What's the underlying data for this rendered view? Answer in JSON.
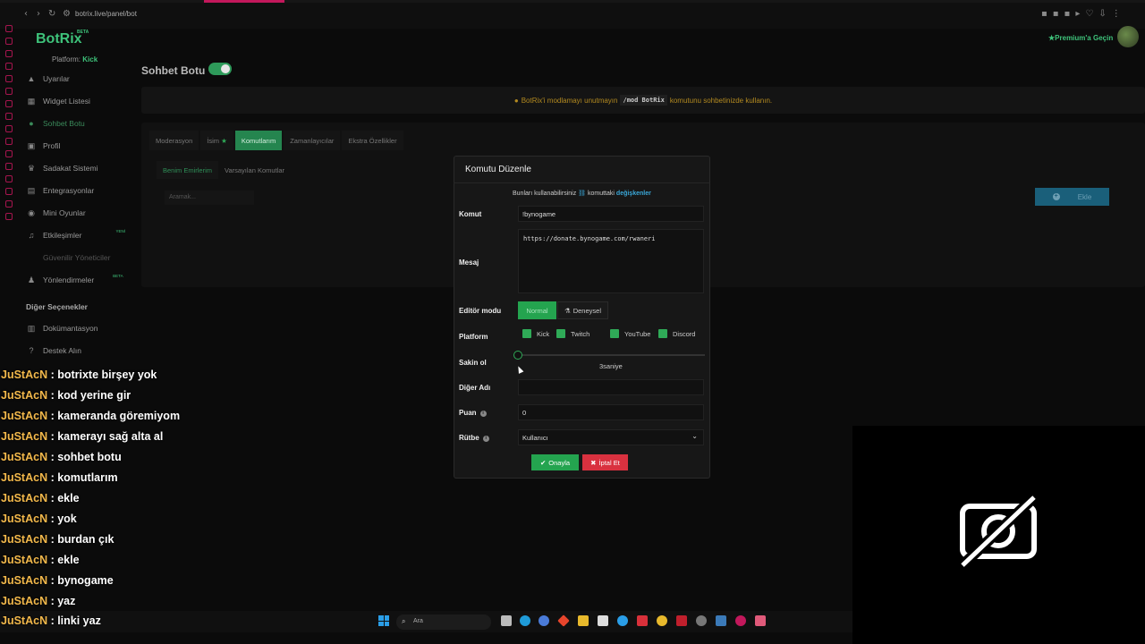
{
  "browser": {
    "url": "botrix.live/panel/bot"
  },
  "brand": {
    "name": "BotRix",
    "beta": "BETA",
    "platform_label": "Platform:",
    "platform_value": "Kick"
  },
  "premium": {
    "label": "Premium'a Geçin"
  },
  "sidebar": {
    "items": [
      {
        "label": "Uyarılar",
        "icon": "warning-icon"
      },
      {
        "label": "Widget Listesi",
        "icon": "grid-icon"
      },
      {
        "label": "Sohbet Botu",
        "icon": "chat-icon"
      },
      {
        "label": "Profil",
        "icon": "user-icon"
      },
      {
        "label": "Sadakat Sistemi",
        "icon": "trophy-icon"
      },
      {
        "label": "Entegrasyonlar",
        "icon": "plug-icon"
      },
      {
        "label": "Mini Oyunlar",
        "icon": "gamepad-icon"
      },
      {
        "label": "Etkileşimler",
        "icon": "music-icon",
        "badge": "YENİ"
      },
      {
        "label": "Güvenilir Yöneticiler",
        "icon": "shield-icon"
      },
      {
        "label": "Yönlendirmeler",
        "icon": "users-icon",
        "badge": "BETA"
      }
    ],
    "section_title": "Diğer Seçenekler",
    "other": [
      {
        "label": "Dokümantasyon",
        "icon": "book-icon"
      },
      {
        "label": "Destek Alın",
        "icon": "question-icon"
      }
    ]
  },
  "main": {
    "title": "Sohbet Botu",
    "alert_pre": "BotRix'i modlamayı unutmayın",
    "alert_code": "/mod BotRix",
    "alert_post": "komutunu sohbetinizde kullanın.",
    "tabs": [
      "Moderasyon",
      "İsim",
      "Komutlarım",
      "Zamanlayıcılar",
      "Ekstra Özellikler"
    ],
    "subtabs": [
      "Benim Emirlerim",
      "Varsayılan Komutlar"
    ],
    "search_placeholder": "Aramak...",
    "add_label": "Ekle"
  },
  "modal": {
    "title": "Komutu Düzenle",
    "info_pre": "Bunları kullanabilirsiniz",
    "info_mid": "komuttaki",
    "info_link": "değişkenler",
    "fields": {
      "command_label": "Komut",
      "command_value": "!bynogame",
      "message_label": "Mesaj",
      "message_value": "https://donate.bynogame.com/rwaneri",
      "editor_label": "Editör modu",
      "editor_normal": "Normal",
      "editor_exp": "Deneysel",
      "platform_label": "Platform",
      "platforms": [
        "Kick",
        "Twitch",
        "YouTube",
        "Discord"
      ],
      "cooldown_label": "Sakin ol",
      "cooldown_value": "3saniye",
      "alias_label": "Diğer Adı",
      "alias_value": "",
      "points_label": "Puan",
      "points_value": "0",
      "rank_label": "Rütbe",
      "rank_value": "Kullanıcı"
    },
    "confirm": "Onayla",
    "cancel": "İptal Et"
  },
  "chat": [
    {
      "user": "JuStAcN",
      "msg": "botrixte birşey yok"
    },
    {
      "user": "JuStAcN",
      "msg": "kod yerine gir"
    },
    {
      "user": "JuStAcN",
      "msg": "kameranda göremiyom"
    },
    {
      "user": "JuStAcN",
      "msg": "kamerayı sağ alta al"
    },
    {
      "user": "JuStAcN",
      "msg": "sohbet botu"
    },
    {
      "user": "JuStAcN",
      "msg": "komutlarım"
    },
    {
      "user": "JuStAcN",
      "msg": "ekle"
    },
    {
      "user": "JuStAcN",
      "msg": "yok"
    },
    {
      "user": "JuStAcN",
      "msg": "burdan çık"
    },
    {
      "user": "JuStAcN",
      "msg": "ekle"
    },
    {
      "user": "JuStAcN",
      "msg": "bynogame"
    },
    {
      "user": "JuStAcN",
      "msg": "yaz"
    },
    {
      "user": "JuStAcN",
      "msg": "linki yaz"
    }
  ],
  "taskbar": {
    "search_label": "Ara"
  },
  "colors": {
    "accent": "#24a44f",
    "danger": "#d9313f",
    "chat_user": "#f2b84b",
    "warning": "#b38a20"
  }
}
